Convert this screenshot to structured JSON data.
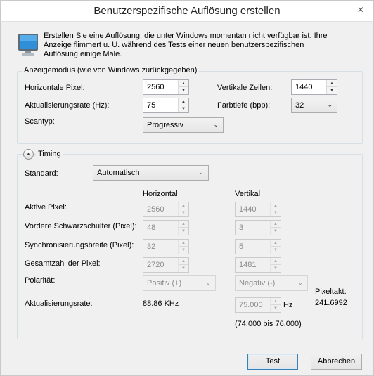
{
  "window": {
    "title": "Benutzerspezifische Auflösung erstellen",
    "close_glyph": "✕"
  },
  "intro_text": "Erstellen Sie eine Auflösung, die unter Windows momentan nicht verfügbar ist. Ihre Anzeige flimmert u. U. während des Tests einer neuen benutzerspezifischen Auflösung einige Male.",
  "display_mode": {
    "legend": "Anzeigemodus (wie von Windows zurückgegeben)",
    "horizontal_pixels_label": "Horizontale Pixel:",
    "horizontal_pixels_value": "2560",
    "vertical_lines_label": "Vertikale Zeilen:",
    "vertical_lines_value": "1440",
    "refresh_rate_label": "Aktualisierungsrate (Hz):",
    "refresh_rate_value": "75",
    "color_depth_label": "Farbtiefe (bpp):",
    "color_depth_value": "32",
    "scan_type_label": "Scantyp:",
    "scan_type_value": "Progressiv"
  },
  "timing": {
    "legend": "Timing",
    "standard_label": "Standard:",
    "standard_value": "Automatisch",
    "col_horizontal": "Horizontal",
    "col_vertical": "Vertikal",
    "rows": [
      {
        "label": "Aktive Pixel:",
        "h": "2560",
        "v": "1440"
      },
      {
        "label": "Vordere Schwarzschulter (Pixel):",
        "h": "48",
        "v": "3"
      },
      {
        "label": "Synchronisierungsbreite (Pixel):",
        "h": "32",
        "v": "5"
      },
      {
        "label": "Gesamtzahl der Pixel:",
        "h": "2720",
        "v": "1481"
      }
    ],
    "polarity_label": "Polarität:",
    "polarity_h": "Positiv (+)",
    "polarity_v": "Negativ (-)",
    "refresh_label": "Aktualisierungsrate:",
    "refresh_h": "88.86 KHz",
    "refresh_v": "75.000",
    "refresh_v_unit": "Hz",
    "refresh_range": "(74.000 bis 76.000)",
    "pixel_clock_label": "Pixeltakt:",
    "pixel_clock_value": "241.6992"
  },
  "buttons": {
    "test": "Test",
    "cancel": "Abbrechen"
  },
  "icons": {
    "spin_up": "▲",
    "spin_down": "▼",
    "dropdown": "⌄",
    "collapse": "▲"
  }
}
